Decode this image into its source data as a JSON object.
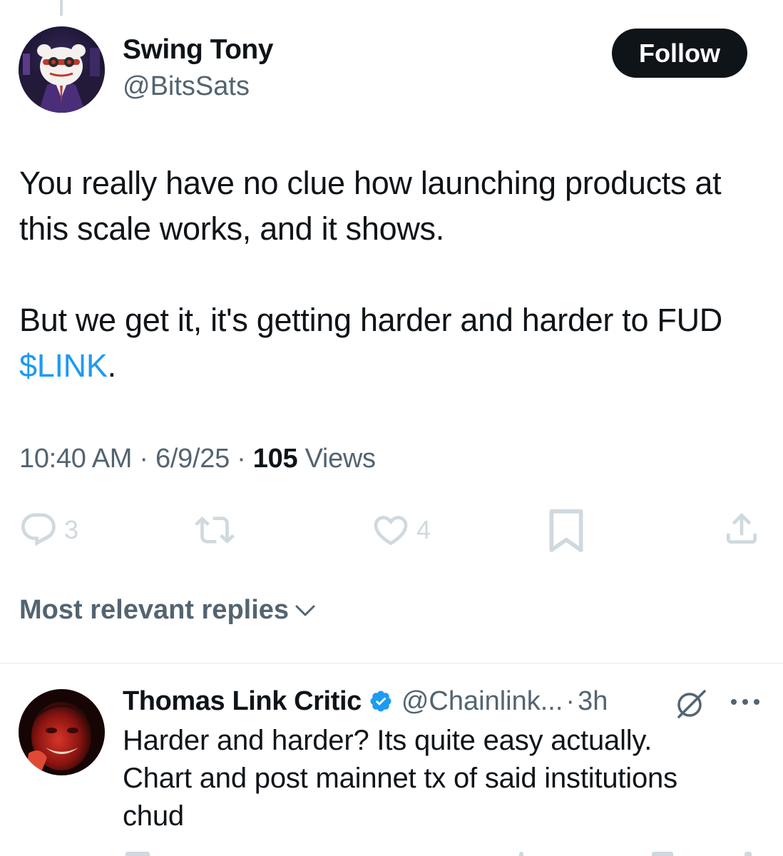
{
  "tweet": {
    "author": {
      "display_name": "Swing Tony",
      "handle": "@BitsSats"
    },
    "follow_label": "Follow",
    "paragraphs": [
      {
        "text": "You really have no clue how launching products at this scale works, and it shows."
      },
      {
        "prefix": "But we get it, it's getting harder and harder to FUD ",
        "cashtag": "$LINK",
        "suffix": "."
      }
    ],
    "meta": {
      "time": "10:40 AM",
      "date": "6/9/25",
      "views_count": "105",
      "views_label": "Views",
      "separator": "·"
    },
    "actions": {
      "reply_count": "3",
      "retweet_count": "",
      "like_count": "4"
    },
    "icons": {
      "reply": "reply-icon",
      "retweet": "retweet-icon",
      "like": "heart-icon",
      "bookmark": "bookmark-icon",
      "share": "share-icon"
    }
  },
  "replies_section": {
    "sort_label": "Most relevant replies"
  },
  "reply": {
    "display_name": "Thomas Link Critic",
    "verified": true,
    "handle": "@Chainlink...",
    "separator": "·",
    "time": "3h",
    "lines": [
      "Harder and harder? Its quite easy actually.",
      "Chart and post mainnet tx of said institutions",
      "chud"
    ]
  },
  "colors": {
    "text_primary": "#0f1419",
    "text_secondary": "#536471",
    "accent_blue": "#1d9bf0",
    "icon_muted": "#cfd9de",
    "follow_bg": "#0f1419"
  }
}
